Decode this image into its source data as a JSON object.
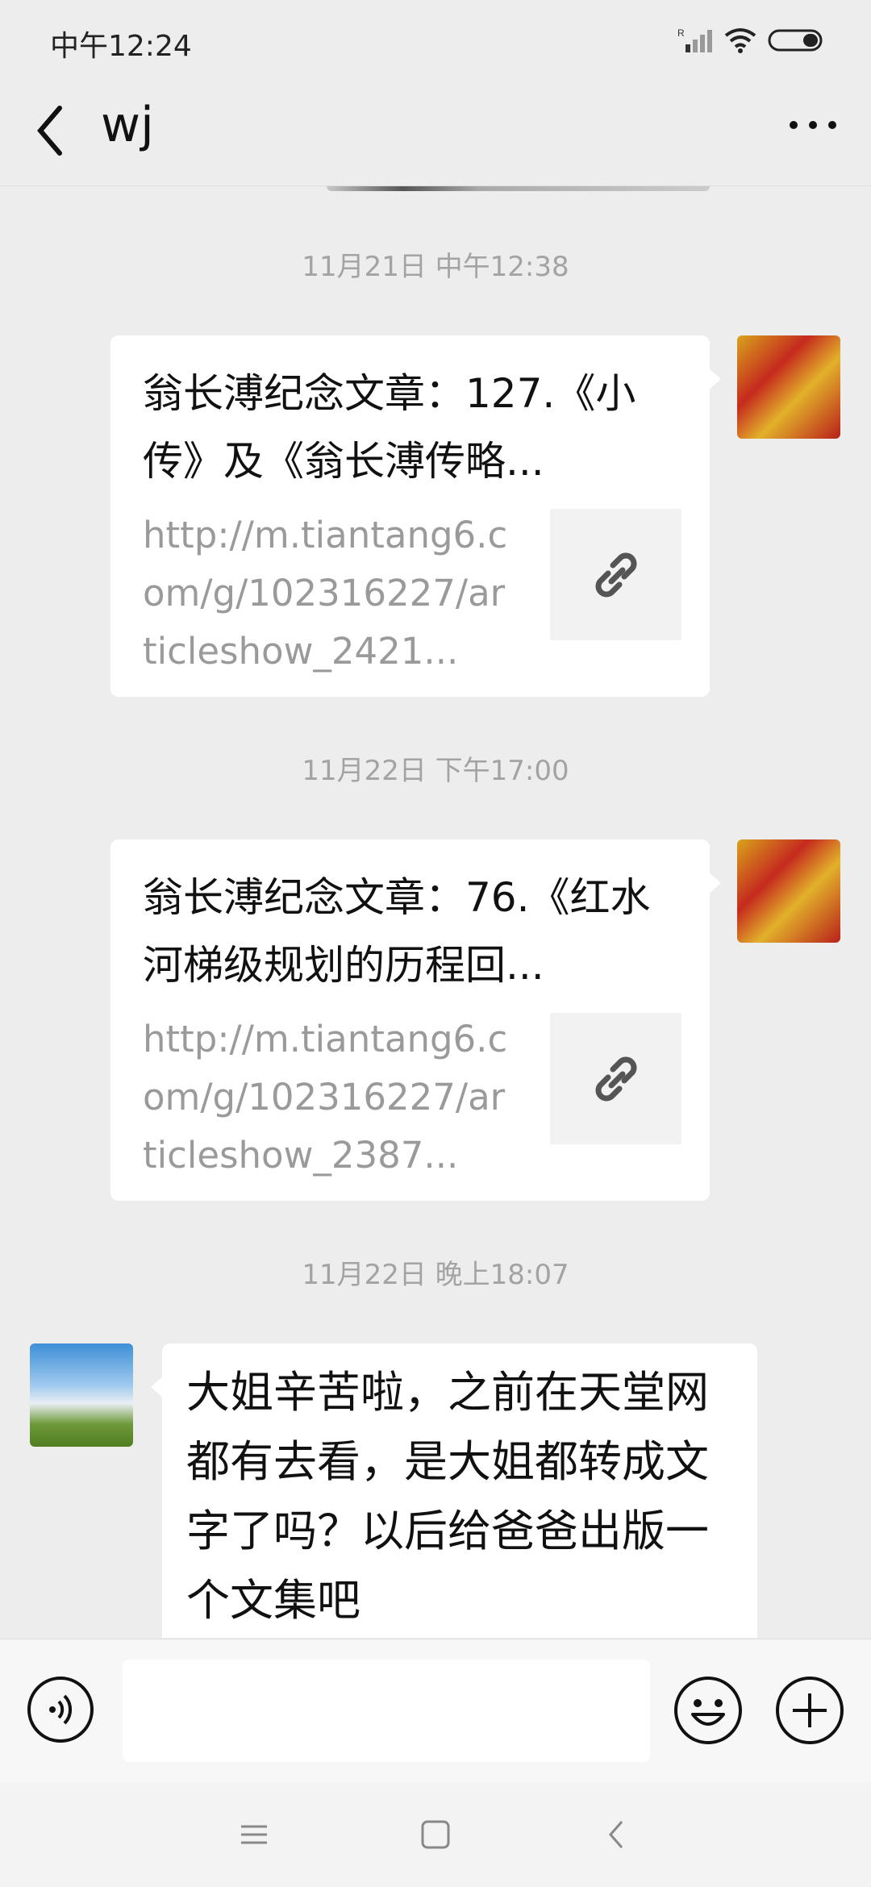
{
  "status_bar": {
    "time": "中午12:24"
  },
  "header": {
    "title": "wj"
  },
  "messages": [
    {
      "timestamp": "11月21日 中午12:38",
      "title": "翁长溥纪念文章：127.《小传》及《翁长溥传略...",
      "url": "http://m.tiantang6.com/g/102316227/articleshow_2421..."
    },
    {
      "timestamp": "11月22日 下午17:00",
      "title": "翁长溥纪念文章：76.《红水河梯级规划的历程回...",
      "url": "http://m.tiantang6.com/g/102316227/articleshow_2387..."
    },
    {
      "timestamp": "11月22日 晚上18:07",
      "text": "大姐辛苦啦，之前在天堂网都有去看，是大姐都转成文字了吗？以后给爸爸出版一个文集吧"
    }
  ],
  "input": {
    "placeholder": ""
  },
  "icons": {
    "back": "back-chevron-icon",
    "more": "more-dots-icon",
    "link": "link-icon",
    "voice": "voice-icon",
    "emoji": "emoji-icon",
    "plus": "plus-icon"
  }
}
